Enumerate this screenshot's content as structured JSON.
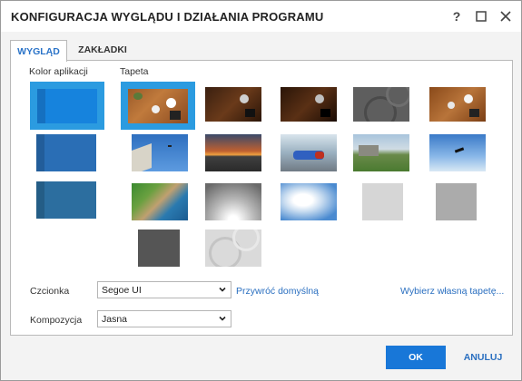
{
  "window": {
    "title": "KONFIGURACJA WYGLĄDU I DZIAŁANIA PROGRAMU",
    "help_icon": "question-mark-icon",
    "maximize_icon": "maximize-icon",
    "close_icon": "close-icon"
  },
  "tabs": [
    {
      "label": "WYGLĄD",
      "active": true
    },
    {
      "label": "ZAKŁADKI",
      "active": false
    }
  ],
  "sections": {
    "app_color_label": "Kolor aplikacji",
    "wallpaper_label": "Tapeta"
  },
  "app_colors": [
    {
      "name": "blue-bright",
      "color": "#1683dd",
      "selected": true
    },
    {
      "name": "blue-medium",
      "color": "#2a6eb5",
      "selected": false
    },
    {
      "name": "blue-steel",
      "color": "#2c6e9f",
      "selected": false
    }
  ],
  "wallpapers": [
    {
      "name": "desk-wood-1",
      "selected": true
    },
    {
      "name": "desk-wood-dark",
      "selected": false
    },
    {
      "name": "desk-wood-darker",
      "selected": false
    },
    {
      "name": "gray-circles",
      "selected": false
    },
    {
      "name": "desk-wood-2",
      "selected": false
    },
    {
      "name": "building-sky",
      "selected": false
    },
    {
      "name": "sunset-road",
      "selected": false
    },
    {
      "name": "car-motion",
      "selected": false
    },
    {
      "name": "hills-landscape",
      "selected": false
    },
    {
      "name": "bird-sky",
      "selected": false
    },
    {
      "name": "coast-cliffs",
      "selected": false
    },
    {
      "name": "gray-gradient",
      "selected": false
    },
    {
      "name": "clouds",
      "selected": false
    },
    {
      "name": "light-gray",
      "selected": false
    },
    {
      "name": "medium-gray",
      "selected": false
    },
    {
      "name": "dark-gray",
      "selected": false
    },
    {
      "name": "light-circles",
      "selected": false
    }
  ],
  "font": {
    "label": "Czcionka",
    "value": "Segoe UI",
    "reset_link": "Przywróć domyślną",
    "custom_wallpaper_link": "Wybierz własną tapetę..."
  },
  "composition": {
    "label": "Kompozycja",
    "value": "Jasna"
  },
  "buttons": {
    "ok": "OK",
    "cancel": "ANULUJ"
  },
  "colors": {
    "accent": "#1877d8",
    "selection": "#2b9be0",
    "link": "#2a6fc0"
  }
}
